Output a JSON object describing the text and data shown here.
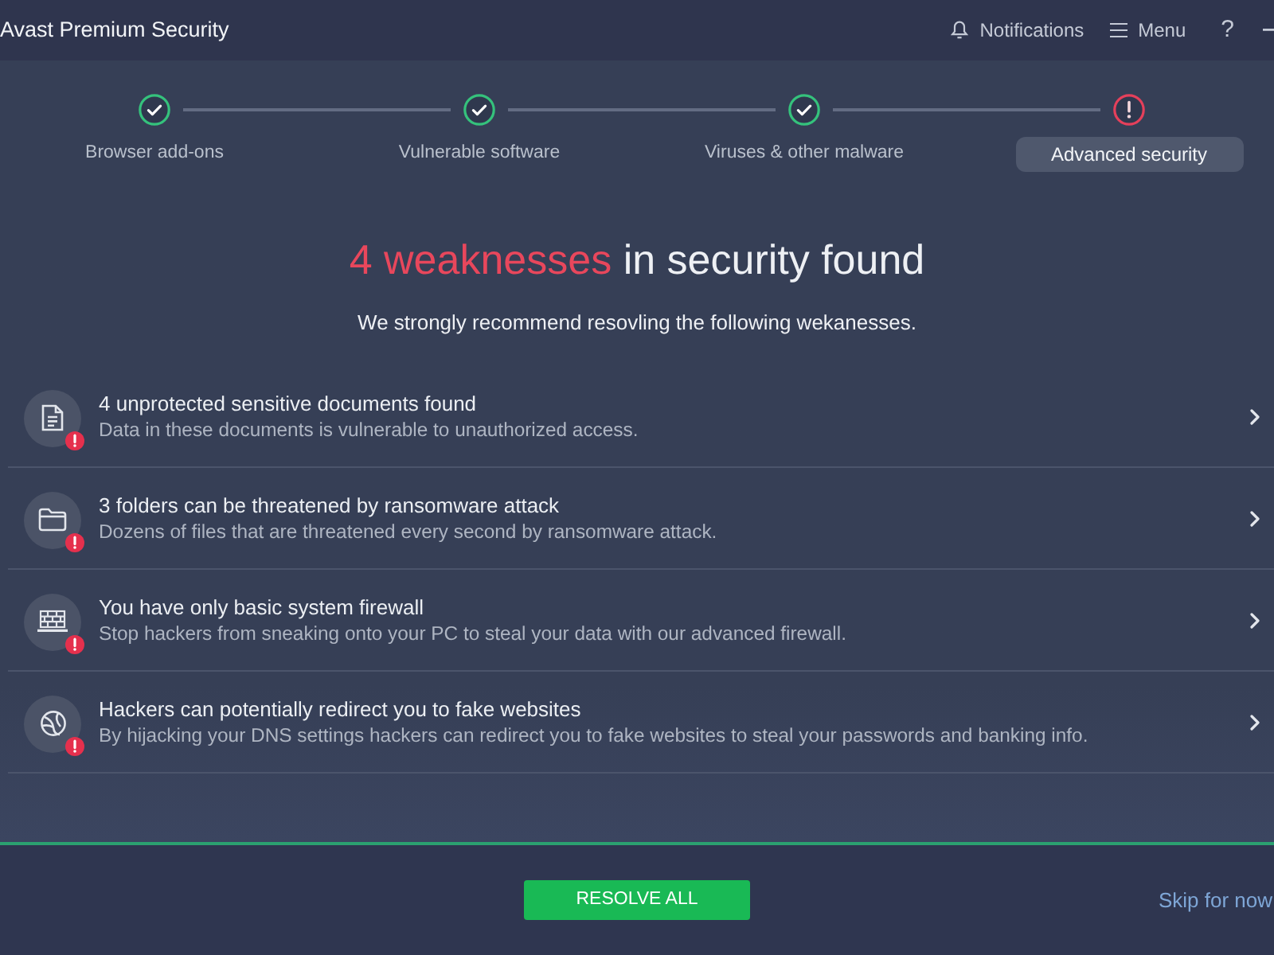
{
  "window": {
    "title": "Avast Premium Security"
  },
  "header_actions": [
    {
      "kind": "notifications",
      "label": "Notifications"
    },
    {
      "kind": "menu",
      "label": "Menu"
    },
    {
      "kind": "help",
      "label": "?"
    },
    {
      "kind": "minimize"
    }
  ],
  "steps": [
    {
      "label": "Browser add-ons",
      "complete": true,
      "selected": false
    },
    {
      "label": "Vulnerable software",
      "complete": true,
      "selected": false
    },
    {
      "label": "Viruses & other malware",
      "complete": true,
      "selected": false
    },
    {
      "label": "Advanced security",
      "complete": false,
      "selected": true
    }
  ],
  "heading": {
    "highlight": "4 weaknesses",
    "rest": "in security found"
  },
  "subtitle": "We strongly recommend resovling the following wekanesses.",
  "issues": [
    {
      "kind": "documents",
      "title": "4 unprotected sensitive documents found",
      "description": "Data in these documents is vulnerable to unauthorized access."
    },
    {
      "kind": "folders",
      "title": "3 folders can be threatened by ransomware attack",
      "description": "Dozens of files that are threatened every second by ransomware attack."
    },
    {
      "kind": "firewall",
      "title": "You have only basic system firewall",
      "description": "Stop hackers from sneaking onto your PC to steal your data with our advanced firewall."
    },
    {
      "kind": "dns",
      "title": "Hackers can potentially redirect you to fake websites",
      "description": "By hijacking your DNS settings hackers can redirect you to fake websites to steal your passwords and banking info."
    }
  ],
  "resolve_button": "RESOLVE ALL",
  "skip_link": "Skip for now"
}
